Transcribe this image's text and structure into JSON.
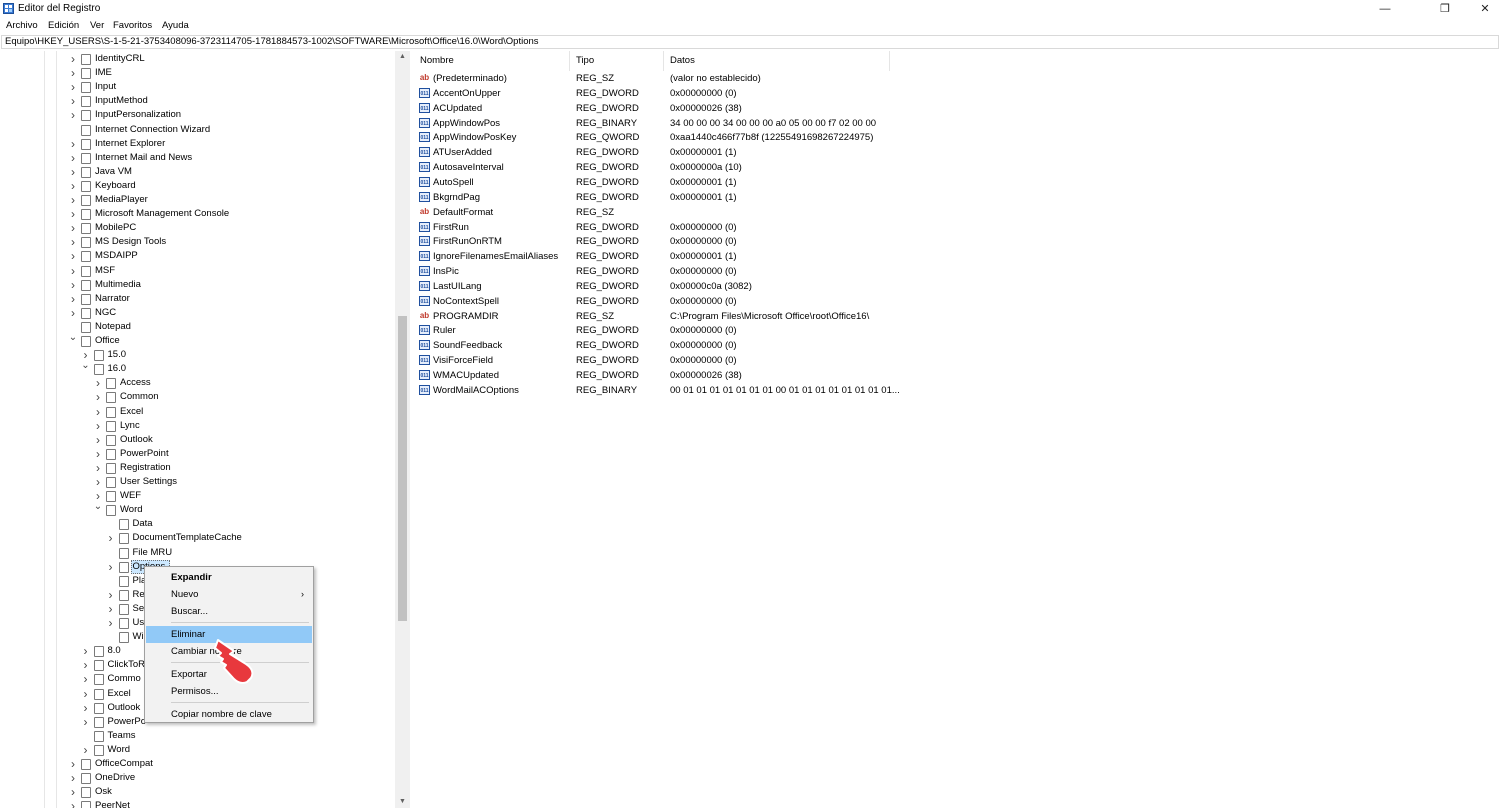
{
  "window": {
    "title": "Editor del Registro",
    "controls": {
      "minimize": "—",
      "restore": "❐",
      "close": "✕"
    }
  },
  "menubar": {
    "items": [
      "Archivo",
      "Edición",
      "Ver",
      "Favoritos",
      "Ayuda"
    ]
  },
  "address": "Equipo\\HKEY_USERS\\S-1-5-21-3753408096-3723114705-1781884573-1002\\SOFTWARE\\Microsoft\\Office\\16.0\\Word\\Options",
  "tree": [
    {
      "label": "IdentityCRL",
      "level": 0,
      "expand": "closed"
    },
    {
      "label": "IME",
      "level": 0,
      "expand": "closed"
    },
    {
      "label": "Input",
      "level": 0,
      "expand": "closed"
    },
    {
      "label": "InputMethod",
      "level": 0,
      "expand": "closed"
    },
    {
      "label": "InputPersonalization",
      "level": 0,
      "expand": "closed"
    },
    {
      "label": "Internet Connection Wizard",
      "level": 0,
      "expand": "none"
    },
    {
      "label": "Internet Explorer",
      "level": 0,
      "expand": "closed"
    },
    {
      "label": "Internet Mail and News",
      "level": 0,
      "expand": "closed"
    },
    {
      "label": "Java VM",
      "level": 0,
      "expand": "closed"
    },
    {
      "label": "Keyboard",
      "level": 0,
      "expand": "closed"
    },
    {
      "label": "MediaPlayer",
      "level": 0,
      "expand": "closed"
    },
    {
      "label": "Microsoft Management Console",
      "level": 0,
      "expand": "closed"
    },
    {
      "label": "MobilePC",
      "level": 0,
      "expand": "closed"
    },
    {
      "label": "MS Design Tools",
      "level": 0,
      "expand": "closed"
    },
    {
      "label": "MSDAIPP",
      "level": 0,
      "expand": "closed"
    },
    {
      "label": "MSF",
      "level": 0,
      "expand": "closed"
    },
    {
      "label": "Multimedia",
      "level": 0,
      "expand": "closed"
    },
    {
      "label": "Narrator",
      "level": 0,
      "expand": "closed"
    },
    {
      "label": "NGC",
      "level": 0,
      "expand": "closed"
    },
    {
      "label": "Notepad",
      "level": 0,
      "expand": "none"
    },
    {
      "label": "Office",
      "level": 0,
      "expand": "open"
    },
    {
      "label": "15.0",
      "level": 1,
      "expand": "closed"
    },
    {
      "label": "16.0",
      "level": 1,
      "expand": "open"
    },
    {
      "label": "Access",
      "level": 2,
      "expand": "closed"
    },
    {
      "label": "Common",
      "level": 2,
      "expand": "closed"
    },
    {
      "label": "Excel",
      "level": 2,
      "expand": "closed"
    },
    {
      "label": "Lync",
      "level": 2,
      "expand": "closed"
    },
    {
      "label": "Outlook",
      "level": 2,
      "expand": "closed"
    },
    {
      "label": "PowerPoint",
      "level": 2,
      "expand": "closed"
    },
    {
      "label": "Registration",
      "level": 2,
      "expand": "closed"
    },
    {
      "label": "User Settings",
      "level": 2,
      "expand": "closed"
    },
    {
      "label": "WEF",
      "level": 2,
      "expand": "closed"
    },
    {
      "label": "Word",
      "level": 2,
      "expand": "open"
    },
    {
      "label": "Data",
      "level": 3,
      "expand": "none"
    },
    {
      "label": "DocumentTemplateCache",
      "level": 3,
      "expand": "closed"
    },
    {
      "label": "File MRU",
      "level": 3,
      "expand": "none"
    },
    {
      "label": "Options",
      "level": 3,
      "expand": "closed",
      "selected": true
    },
    {
      "label": "Pla",
      "level": 3,
      "expand": "none"
    },
    {
      "label": "Re",
      "level": 3,
      "expand": "closed"
    },
    {
      "label": "Se",
      "level": 3,
      "expand": "closed"
    },
    {
      "label": "Us",
      "level": 3,
      "expand": "closed"
    },
    {
      "label": "Wi",
      "level": 3,
      "expand": "none"
    },
    {
      "label": "8.0",
      "level": 1,
      "expand": "closed"
    },
    {
      "label": "ClickToR",
      "level": 1,
      "expand": "closed"
    },
    {
      "label": "Commo",
      "level": 1,
      "expand": "closed"
    },
    {
      "label": "Excel",
      "level": 1,
      "expand": "closed"
    },
    {
      "label": "Outlook",
      "level": 1,
      "expand": "closed"
    },
    {
      "label": "PowerPo",
      "level": 1,
      "expand": "closed"
    },
    {
      "label": "Teams",
      "level": 1,
      "expand": "none"
    },
    {
      "label": "Word",
      "level": 1,
      "expand": "closed"
    },
    {
      "label": "OfficeCompat",
      "level": 0,
      "expand": "closed"
    },
    {
      "label": "OneDrive",
      "level": 0,
      "expand": "closed"
    },
    {
      "label": "Osk",
      "level": 0,
      "expand": "closed"
    },
    {
      "label": "PeerNet",
      "level": 0,
      "expand": "closed"
    }
  ],
  "list": {
    "columns": [
      "Nombre",
      "Tipo",
      "Datos"
    ],
    "rows": [
      {
        "icon": "sz",
        "name": "(Predeterminado)",
        "type": "REG_SZ",
        "data": "(valor no establecido)"
      },
      {
        "icon": "bin",
        "name": "AccentOnUpper",
        "type": "REG_DWORD",
        "data": "0x00000000 (0)"
      },
      {
        "icon": "bin",
        "name": "ACUpdated",
        "type": "REG_DWORD",
        "data": "0x00000026 (38)"
      },
      {
        "icon": "bin",
        "name": "AppWindowPos",
        "type": "REG_BINARY",
        "data": "34 00 00 00 34 00 00 00 a0 05 00 00 f7 02 00 00"
      },
      {
        "icon": "bin",
        "name": "AppWindowPosKey",
        "type": "REG_QWORD",
        "data": "0xaa1440c466f77b8f (12255491698267224975)"
      },
      {
        "icon": "bin",
        "name": "ATUserAdded",
        "type": "REG_DWORD",
        "data": "0x00000001 (1)"
      },
      {
        "icon": "bin",
        "name": "AutosaveInterval",
        "type": "REG_DWORD",
        "data": "0x0000000a (10)"
      },
      {
        "icon": "bin",
        "name": "AutoSpell",
        "type": "REG_DWORD",
        "data": "0x00000001 (1)"
      },
      {
        "icon": "bin",
        "name": "BkgrndPag",
        "type": "REG_DWORD",
        "data": "0x00000001 (1)"
      },
      {
        "icon": "sz",
        "name": "DefaultFormat",
        "type": "REG_SZ",
        "data": ""
      },
      {
        "icon": "bin",
        "name": "FirstRun",
        "type": "REG_DWORD",
        "data": "0x00000000 (0)"
      },
      {
        "icon": "bin",
        "name": "FirstRunOnRTM",
        "type": "REG_DWORD",
        "data": "0x00000000 (0)"
      },
      {
        "icon": "bin",
        "name": "IgnoreFilenamesEmailAliases",
        "type": "REG_DWORD",
        "data": "0x00000001 (1)"
      },
      {
        "icon": "bin",
        "name": "InsPic",
        "type": "REG_DWORD",
        "data": "0x00000000 (0)"
      },
      {
        "icon": "bin",
        "name": "LastUILang",
        "type": "REG_DWORD",
        "data": "0x00000c0a (3082)"
      },
      {
        "icon": "bin",
        "name": "NoContextSpell",
        "type": "REG_DWORD",
        "data": "0x00000000 (0)"
      },
      {
        "icon": "sz",
        "name": "PROGRAMDIR",
        "type": "REG_SZ",
        "data": "C:\\Program Files\\Microsoft Office\\root\\Office16\\"
      },
      {
        "icon": "bin",
        "name": "Ruler",
        "type": "REG_DWORD",
        "data": "0x00000000 (0)"
      },
      {
        "icon": "bin",
        "name": "SoundFeedback",
        "type": "REG_DWORD",
        "data": "0x00000000 (0)"
      },
      {
        "icon": "bin",
        "name": "VisiForceField",
        "type": "REG_DWORD",
        "data": "0x00000000 (0)"
      },
      {
        "icon": "bin",
        "name": "WMACUpdated",
        "type": "REG_DWORD",
        "data": "0x00000026 (38)"
      },
      {
        "icon": "bin",
        "name": "WordMailACOptions",
        "type": "REG_BINARY",
        "data": "00 01 01 01 01 01 01 01 00 01 01 01 01 01 01 01 01..."
      }
    ]
  },
  "icon_glyphs": {
    "sz": "ab",
    "bin": "011"
  },
  "context_menu": {
    "items": [
      {
        "label": "Expandir",
        "bold": true
      },
      {
        "label": "Nuevo",
        "submenu": true
      },
      {
        "label": "Buscar..."
      },
      {
        "separator": true
      },
      {
        "label": "Eliminar",
        "highlighted": true
      },
      {
        "label": "Cambiar nombre"
      },
      {
        "separator": true
      },
      {
        "label": "Exportar"
      },
      {
        "label": "Permisos..."
      },
      {
        "separator": true
      },
      {
        "label": "Copiar nombre de clave"
      }
    ]
  },
  "colors": {
    "selection": "#cce8ff",
    "menu_highlight": "#91c9f7",
    "cursor_red": "#e8383d"
  }
}
